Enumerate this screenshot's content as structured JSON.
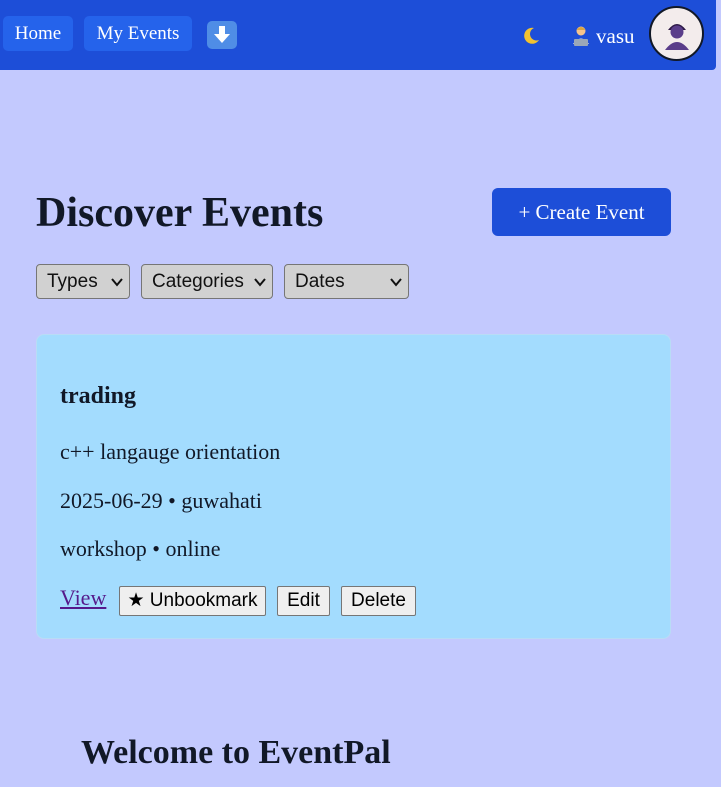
{
  "nav": {
    "home_label": "Home",
    "my_events_label": "My Events",
    "username": "vasu",
    "brand_color": "#1d4ed8"
  },
  "page": {
    "title": "Discover Events",
    "create_label": "+ Create Event",
    "welcome_title": "Welcome to EventPal"
  },
  "filters": {
    "types": "Types",
    "categories": "Categories",
    "dates": "Dates"
  },
  "event": {
    "title": "trading",
    "description": "c++ langauge orientation",
    "date_location": "2025-06-29 • guwahati",
    "type_mode": "workshop • online",
    "view_label": "View",
    "unbookmark_label": "★ Unbookmark",
    "edit_label": "Edit",
    "delete_label": "Delete"
  },
  "icons": [
    "download-icon",
    "moon-icon",
    "user-laptop-icon",
    "avatar-icon",
    "chevron-down-icon"
  ]
}
